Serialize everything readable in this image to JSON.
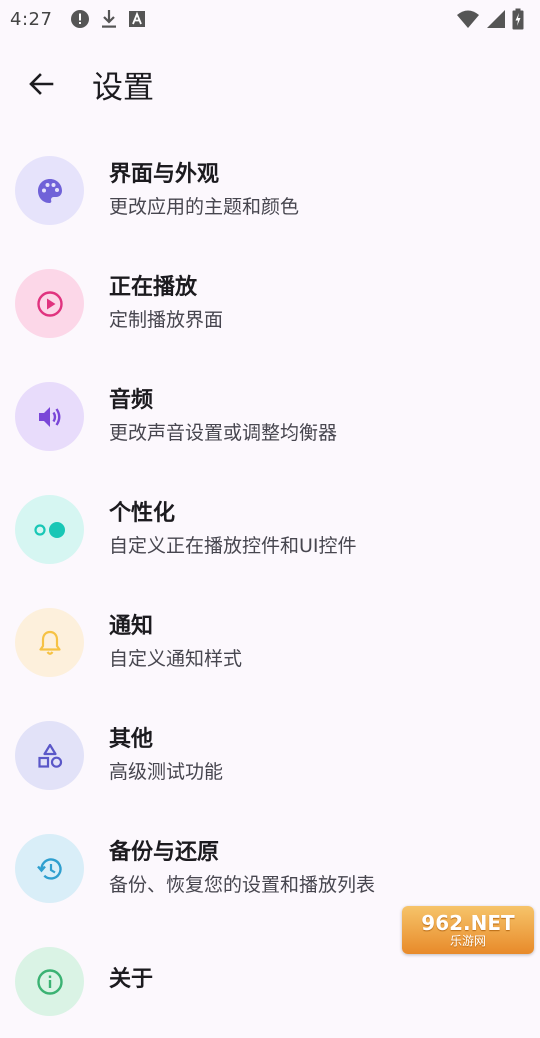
{
  "status_bar": {
    "time": "4:27",
    "left_icons": [
      "alert-circle-icon",
      "download-icon",
      "font-a-icon"
    ],
    "right_icons": [
      "wifi-icon",
      "cell-signal-icon",
      "battery-charging-icon"
    ]
  },
  "app_bar": {
    "back_icon": "arrow-back-icon",
    "title": "设置"
  },
  "settings": [
    {
      "title": "界面与外观",
      "subtitle": "更改应用的主题和颜色",
      "icon": "palette-icon",
      "icon_color": "#7062d8",
      "bg_color": "#e6e3fb"
    },
    {
      "title": "正在播放",
      "subtitle": "定制播放界面",
      "icon": "play-circle-icon",
      "icon_color": "#e0337f",
      "bg_color": "#fcd7e8"
    },
    {
      "title": "音频",
      "subtitle": "更改声音设置或调整均衡器",
      "icon": "volume-icon",
      "icon_color": "#7a46d8",
      "bg_color": "#e8dcfb"
    },
    {
      "title": "个性化",
      "subtitle": "自定义正在播放控件和UI控件",
      "icon": "toggle-dots-icon",
      "icon_color": "#19c7b6",
      "bg_color": "#d6f6f2"
    },
    {
      "title": "通知",
      "subtitle": "自定义通知样式",
      "icon": "bell-icon",
      "icon_color": "#f6c244",
      "bg_color": "#fdf0dc"
    },
    {
      "title": "其他",
      "subtitle": "高级测试功能",
      "icon": "shapes-icon",
      "icon_color": "#5a57c8",
      "bg_color": "#e2e2f8"
    },
    {
      "title": "备份与还原",
      "subtitle": "备份、恢复您的设置和播放列表",
      "icon": "restore-icon",
      "icon_color": "#2f9fcf",
      "bg_color": "#d9eef8"
    },
    {
      "title": "关于",
      "subtitle": "",
      "icon": "info-icon",
      "icon_color": "#3bb273",
      "bg_color": "#daf3e5"
    }
  ],
  "watermark": {
    "top": "962.NET",
    "bottom": "乐游网"
  }
}
